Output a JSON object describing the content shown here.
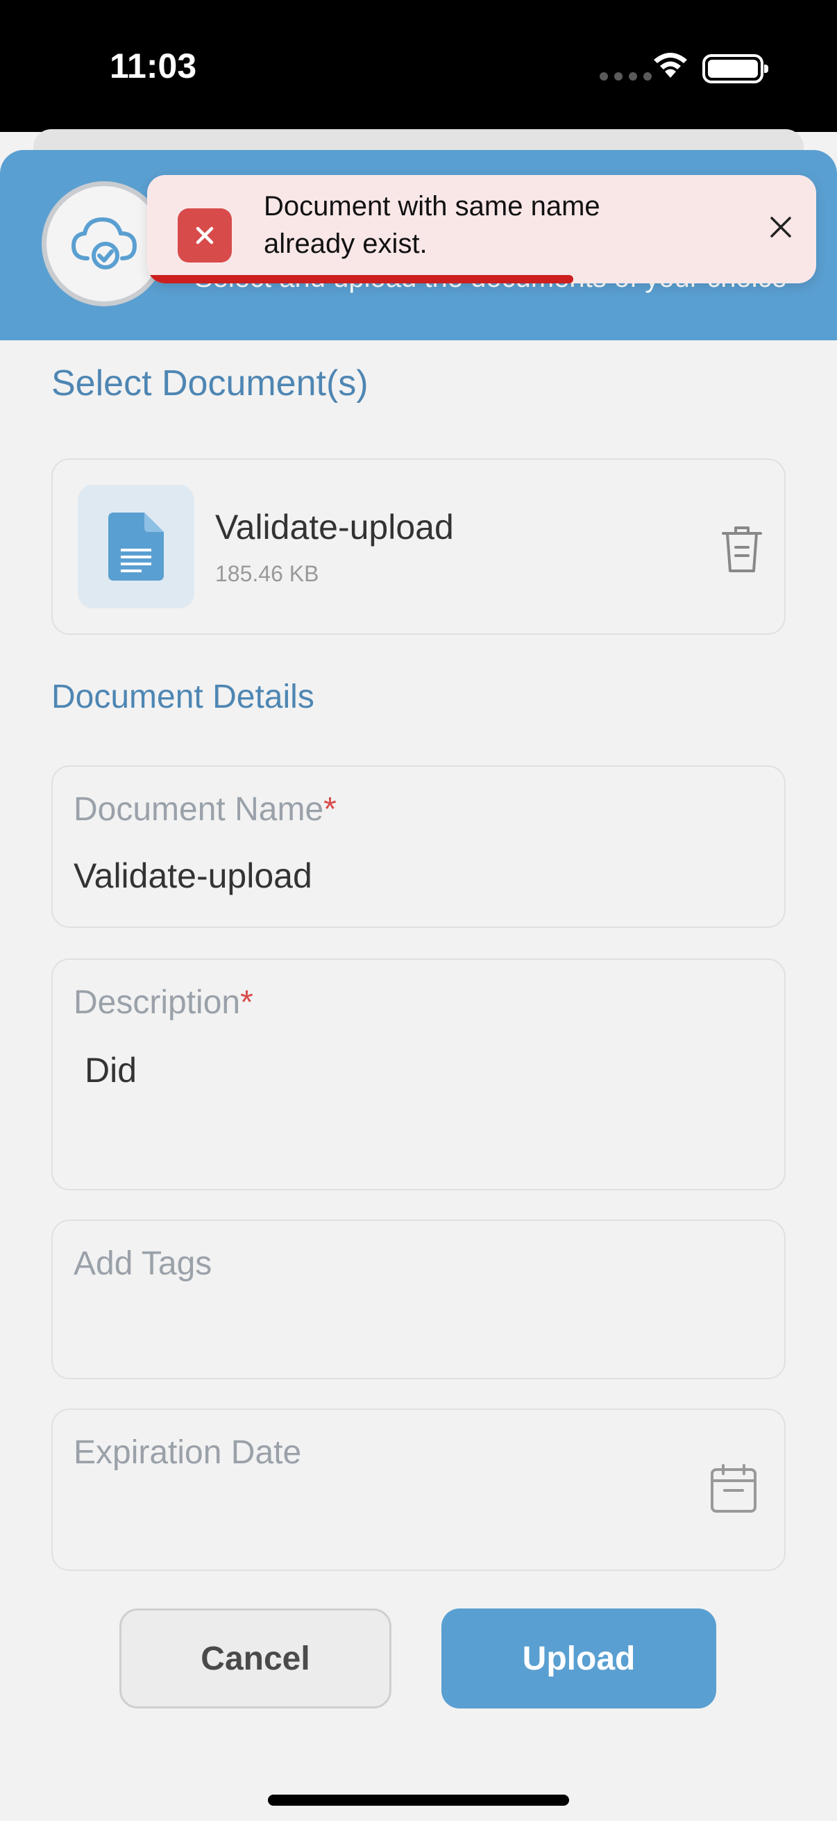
{
  "status_bar": {
    "time": "11:03"
  },
  "header": {
    "subtitle": "Select and upload the documents of your choice"
  },
  "toast": {
    "message": "Document with same name already exist."
  },
  "select_section": {
    "title": "Select Document(s)"
  },
  "file": {
    "name": "Validate-upload",
    "size": "185.46 KB"
  },
  "details_section": {
    "title": "Document Details"
  },
  "fields": {
    "document_name": {
      "label": "Document Name",
      "required": "*",
      "value": "Validate-upload"
    },
    "description": {
      "label": "Description",
      "required": "*",
      "value": "Did"
    },
    "tags": {
      "placeholder": "Add Tags"
    },
    "expiration": {
      "placeholder": "Expiration Date"
    }
  },
  "buttons": {
    "cancel": "Cancel",
    "upload": "Upload"
  },
  "colors": {
    "accent": "#5a9fd1",
    "error": "#d84b4b",
    "toast_bg": "#f9e7e8"
  }
}
